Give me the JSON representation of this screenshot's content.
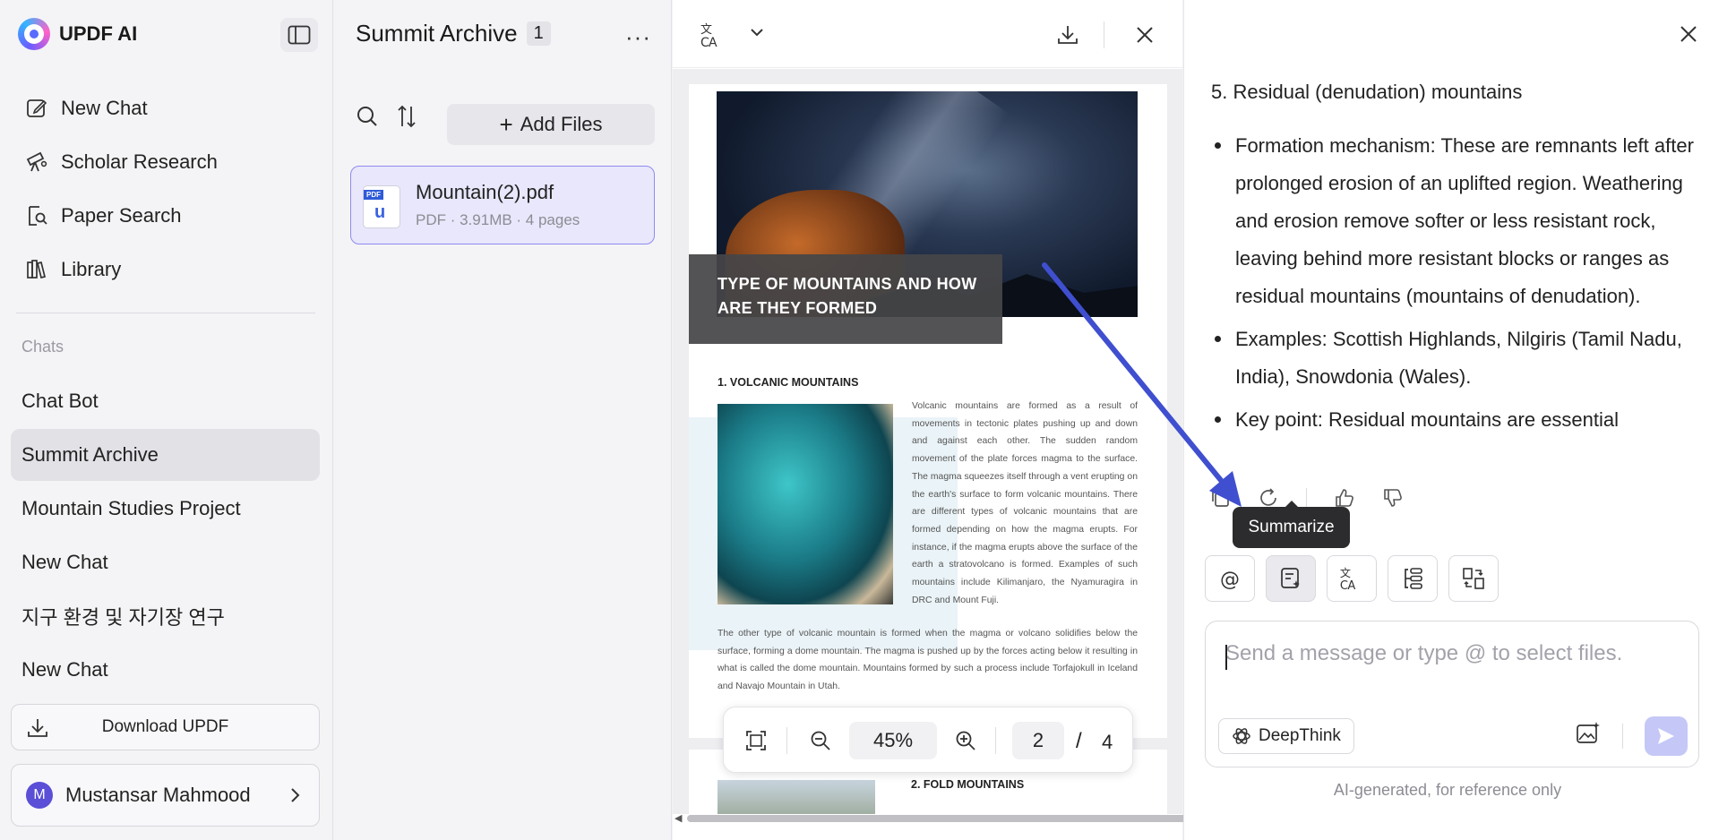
{
  "app": {
    "name": "UPDF AI"
  },
  "nav": [
    {
      "label": "New Chat",
      "icon": "edit-icon"
    },
    {
      "label": "Scholar Research",
      "icon": "telescope-icon"
    },
    {
      "label": "Paper Search",
      "icon": "doc-search-icon"
    },
    {
      "label": "Library",
      "icon": "library-icon"
    }
  ],
  "chats": {
    "section_label": "Chats",
    "items": [
      "Chat Bot",
      "Summit Archive",
      "Mountain Studies Project",
      "New Chat",
      "지구 환경 및 자기장 연구",
      "New Chat"
    ],
    "active_index": 1
  },
  "download_label": "Download UPDF",
  "user": {
    "name": "Mustansar Mahmood",
    "initial": "M"
  },
  "files_panel": {
    "title": "Summit Archive",
    "count": "1",
    "more": "···",
    "add_files": "Add Files",
    "files": [
      {
        "name": "Mountain(2).pdf",
        "meta": "PDF · 3.91MB · 4 pages"
      }
    ]
  },
  "document": {
    "title": "TYPE OF MOUNTAINS AND HOW ARE THEY FORMED",
    "section1": "1. VOLCANIC MOUNTAINS",
    "para1": "Volcanic mountains are formed as a result of movements in tectonic plates pushing up and down and against each other. The sudden random movement of the plate forces magma to the surface. The magma squeezes itself through a vent erupting on the earth's surface to form volcanic mountains. There are different types of volcanic mountains that are formed depending on how the magma erupts. For instance, if the magma erupts above the surface of the earth a stratovolcano is formed. Examples of such mountains include Kilimanjaro, the Nyamuragira in DRC and Mount Fuji.",
    "para2": "The other type of volcanic mountain is formed when the magma or volcano solidifies below the surface, forming a dome mountain. The magma is pushed up by the forces acting below it resulting in what is called the dome mountain. Mountains formed by such a process include Torfajokull in Iceland and Navajo Mountain in Utah.",
    "section2": "2. FOLD MOUNTAINS"
  },
  "zoom": {
    "value": "45%",
    "page": "2",
    "total": "4",
    "slash": "/"
  },
  "chat_panel": {
    "heading": "5. Residual (denudation) mountains",
    "bullets": [
      "Formation mechanism: These are remnants left after prolonged erosion of an uplifted region. Weathering and erosion remove softer or less resistant rock, leaving behind more resistant blocks or ranges as residual mountains (mountains of denudation).",
      "Examples: Scottish Highlands, Nilgiris (Tamil Nadu, India), Snowdonia (Wales).",
      "Key point: Residual mountains are essential"
    ],
    "tooltip": "Summarize",
    "placeholder": "Send a message or type @ to select files.",
    "deepthink": "DeepThink",
    "disclaimer": "AI-generated, for reference only"
  },
  "colors": {
    "accent": "#5a4fd6",
    "annotation_arrow": "#3f4fcf",
    "file_card_bg": "#e8e7fb"
  }
}
